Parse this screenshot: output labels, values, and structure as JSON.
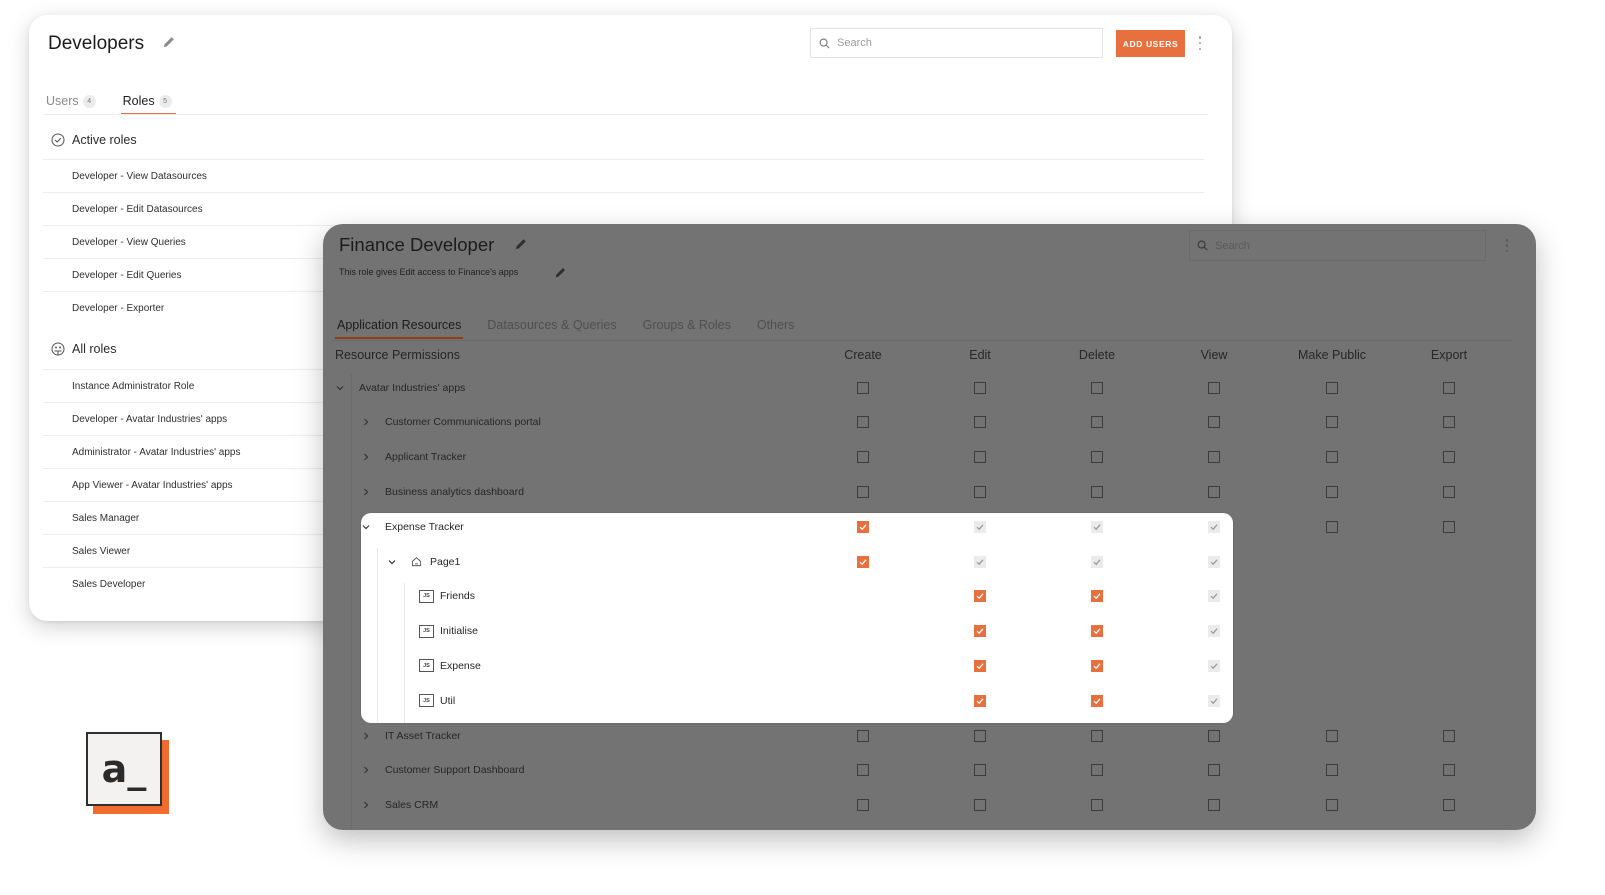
{
  "back_window": {
    "title": "Developers",
    "search": {
      "placeholder": "Search",
      "value": ""
    },
    "add_button_label": "ADD USERS",
    "tabs": [
      {
        "label": "Users",
        "count": "4",
        "active": false
      },
      {
        "label": "Roles",
        "count": "5",
        "active": true
      }
    ],
    "active_roles": {
      "heading": "Active roles",
      "items": [
        "Developer - View Datasources",
        "Developer - Edit Datasources",
        "Developer - View Queries",
        "Developer - Edit Queries",
        "Developer - Exporter"
      ]
    },
    "all_roles": {
      "heading": "All roles",
      "items": [
        "Instance Administrator Role",
        "Developer - Avatar Industries' apps",
        "Administrator - Avatar Industries' apps",
        "App Viewer - Avatar Industries' apps",
        "Sales Manager",
        "Sales Viewer",
        "Sales Developer"
      ]
    }
  },
  "front_window": {
    "title": "Finance Developer",
    "description": "This role gives Edit access to Finance's apps",
    "search": {
      "placeholder": "Search",
      "value": ""
    },
    "tabs": [
      {
        "label": "Application Resources",
        "active": true
      },
      {
        "label": "Datasources & Queries",
        "active": false
      },
      {
        "label": "Groups & Roles",
        "active": false
      },
      {
        "label": "Others",
        "active": false
      }
    ],
    "table": {
      "resource_header": "Resource Permissions",
      "columns": [
        "Create",
        "Edit",
        "Delete",
        "View",
        "Make Public",
        "Export"
      ],
      "rows": [
        {
          "label": "Avatar Industries' apps",
          "level": 0,
          "expanded": true,
          "icon": "chevron",
          "states": [
            "off",
            "off",
            "off",
            "off",
            "off",
            "off"
          ]
        },
        {
          "label": "Customer Communications portal",
          "level": 1,
          "expanded": false,
          "icon": "chevron",
          "states": [
            "off",
            "off",
            "off",
            "off",
            "off",
            "off"
          ]
        },
        {
          "label": "Applicant Tracker",
          "level": 1,
          "expanded": false,
          "icon": "chevron",
          "states": [
            "off",
            "off",
            "off",
            "off",
            "off",
            "off"
          ]
        },
        {
          "label": "Business analytics dashboard",
          "level": 1,
          "expanded": false,
          "icon": "chevron",
          "states": [
            "off",
            "off",
            "off",
            "off",
            "off",
            "off"
          ]
        },
        {
          "label": "Expense Tracker",
          "level": 1,
          "expanded": true,
          "icon": "chevron",
          "highlighted": true,
          "states": [
            "on",
            "disabled",
            "disabled",
            "disabled",
            "off",
            "off"
          ]
        },
        {
          "label": "Page1",
          "level": 2,
          "expanded": true,
          "icon": "home",
          "highlighted": true,
          "states": [
            "on",
            "disabled",
            "disabled",
            "disabled",
            null,
            null
          ]
        },
        {
          "label": "Friends",
          "level": 3,
          "icon": "js",
          "highlighted": true,
          "states": [
            null,
            "on",
            "on",
            "disabled",
            null,
            null
          ]
        },
        {
          "label": "Initialise",
          "level": 3,
          "icon": "js",
          "highlighted": true,
          "states": [
            null,
            "on",
            "on",
            "disabled",
            null,
            null
          ]
        },
        {
          "label": "Expense",
          "level": 3,
          "icon": "js",
          "highlighted": true,
          "states": [
            null,
            "on",
            "on",
            "disabled",
            null,
            null
          ]
        },
        {
          "label": "Util",
          "level": 3,
          "icon": "js",
          "highlighted": true,
          "states": [
            null,
            "on",
            "on",
            "disabled",
            null,
            null
          ]
        },
        {
          "label": "IT Asset Tracker",
          "level": 1,
          "expanded": false,
          "icon": "chevron",
          "states": [
            "off",
            "off",
            "off",
            "off",
            "off",
            "off"
          ]
        },
        {
          "label": "Customer Support Dashboard",
          "level": 1,
          "expanded": false,
          "icon": "chevron",
          "states": [
            "off",
            "off",
            "off",
            "off",
            "off",
            "off"
          ]
        },
        {
          "label": "Sales CRM",
          "level": 1,
          "expanded": false,
          "icon": "chevron",
          "states": [
            "off",
            "off",
            "off",
            "off",
            "off",
            "off"
          ]
        }
      ]
    }
  },
  "logo": {
    "text": "a_"
  },
  "colors": {
    "accent": "#e8703f",
    "overlay": "#737373",
    "logo_accent": "#f26b2e"
  }
}
